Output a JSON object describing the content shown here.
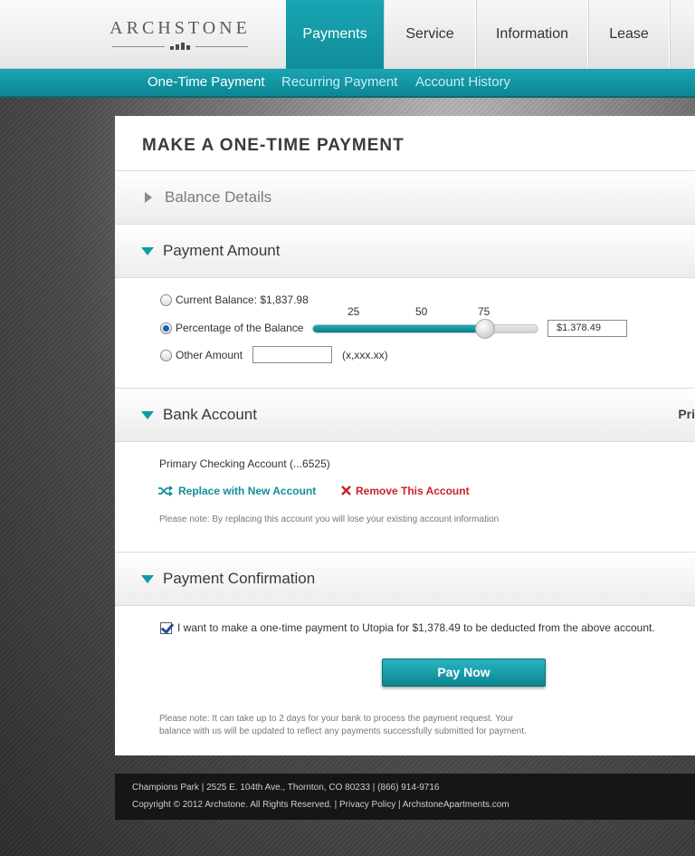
{
  "brand": {
    "name": "ARCHSTONE"
  },
  "nav": {
    "tabs": [
      {
        "label": "Payments",
        "active": true
      },
      {
        "label": "Service",
        "active": false
      },
      {
        "label": "Information",
        "active": false
      },
      {
        "label": "Lease",
        "active": false
      }
    ]
  },
  "subnav": {
    "items": [
      {
        "label": "One-Time Payment",
        "active": true
      },
      {
        "label": "Recurring Payment",
        "active": false
      },
      {
        "label": "Account History",
        "active": false
      }
    ]
  },
  "page": {
    "title": "MAKE A ONE-TIME PAYMENT"
  },
  "sections": {
    "balance": {
      "title": "Balance Details",
      "expanded": false
    },
    "amount": {
      "title": "Payment Amount",
      "expanded": true,
      "options": [
        {
          "label": "Current Balance: $1,837.98",
          "checked": false
        },
        {
          "label": "Percentage of the Balance",
          "checked": true
        },
        {
          "label": "Other Amount",
          "checked": false
        }
      ],
      "slider": {
        "ticks": [
          "25",
          "50",
          "75"
        ],
        "value_percent": 75,
        "amount_value": "$1.378.49"
      },
      "other_amount_value": "",
      "other_amount_hint": "(x,xxx.xx)"
    },
    "bank": {
      "title": "Bank Account",
      "right_label": "Pri",
      "account": "Primary Checking Account (...6525)",
      "replace_label": "Replace with New Account",
      "remove_label": "Remove This Account",
      "note": "Please note: By replacing this account you will lose your existing account information"
    },
    "confirmation": {
      "title": "Payment Confirmation",
      "checked": true,
      "consent": "I want to make a one-time payment to Utopia for $1,378.49 to be deducted from the above account.",
      "pay_button": "Pay Now",
      "note_line1": "Please note: It can take up to 2 days for your bank to process the payment request. Your",
      "note_line2": "balance with us will be updated to reflect any payments successfully submitted for payment."
    }
  },
  "footer": {
    "line1": "Champions Park  |  2525 E. 104th Ave., Thornton, CO 80233  |  (866) 914-9716",
    "line2": "Copyright © 2012 Archstone. All Rights Reserved.  |  Privacy Policy  |  ArchstoneApartments.com"
  },
  "colors": {
    "accent": "#1199a6",
    "danger": "#c8202b",
    "text": "#333333"
  }
}
